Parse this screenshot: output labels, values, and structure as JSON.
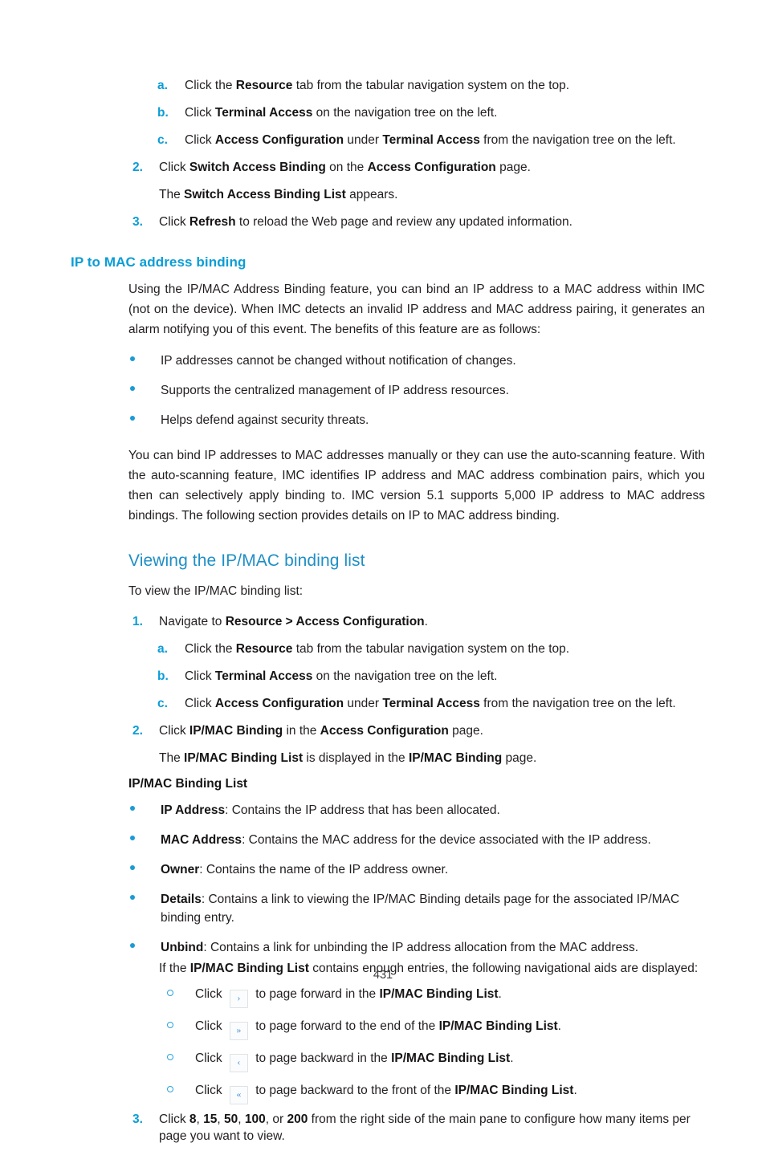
{
  "page": {
    "number": "431"
  },
  "top_steps": {
    "a": {
      "marker": "a.",
      "pre": "Click the ",
      "b1": "Resource",
      "post": " tab from the tabular navigation system on the top."
    },
    "b": {
      "marker": "b.",
      "pre": "Click ",
      "b1": "Terminal Access",
      "post": " on the navigation tree on the left."
    },
    "c": {
      "marker": "c.",
      "pre": "Click ",
      "b1": "Access Configuration",
      "mid": " under ",
      "b2": "Terminal Access",
      "post": " from the navigation tree on the left."
    },
    "step2": {
      "marker": "2.",
      "pre": "Click ",
      "b1": "Switch Access Binding",
      "mid": " on the ",
      "b2": "Access Configuration",
      "post": " page."
    },
    "step2_cont": {
      "pre": "The ",
      "b1": "Switch Access Binding List",
      "post": " appears."
    },
    "step3": {
      "marker": "3.",
      "pre": "Click ",
      "b1": "Refresh",
      "post": " to reload the Web page and review any updated information."
    }
  },
  "section1": {
    "heading": "IP to MAC address binding",
    "intro": "Using the IP/MAC Address Binding feature, you can bind an IP address to a MAC address within IMC (not on the device). When IMC detects an invalid IP address and MAC address pairing, it generates an alarm notifying you of this event. The benefits of this feature are as follows:",
    "benefits": [
      "IP addresses cannot be changed without notification of changes.",
      "Supports the centralized management of IP address resources.",
      "Helps defend against security threats."
    ],
    "outro": "You can bind IP addresses to MAC addresses manually or they can use the auto-scanning feature. With the auto-scanning feature, IMC identifies IP address and MAC address combination pairs, which you then can selectively apply binding to. IMC version 5.1 supports 5,000 IP address to MAC address bindings. The following section provides details on IP to MAC address binding."
  },
  "section2": {
    "heading": "Viewing the IP/MAC binding list",
    "lead": "To view the IP/MAC binding list:",
    "step1": {
      "marker": "1.",
      "pre": "Navigate to ",
      "b1": "Resource > Access Configuration",
      "post": "."
    },
    "a": {
      "marker": "a.",
      "pre": "Click the ",
      "b1": "Resource",
      "post": " tab from the tabular navigation system on the top."
    },
    "b": {
      "marker": "b.",
      "pre": "Click ",
      "b1": "Terminal Access",
      "post": " on the navigation tree on the left."
    },
    "c": {
      "marker": "c.",
      "pre": "Click ",
      "b1": "Access Configuration",
      "mid": " under ",
      "b2": "Terminal Access",
      "post": " from the navigation tree on the left."
    },
    "step2": {
      "marker": "2.",
      "pre": "Click ",
      "b1": "IP/MAC Binding",
      "mid": " in the ",
      "b2": "Access Configuration",
      "post": " page."
    },
    "step2_cont": {
      "pre": "The ",
      "b1": "IP/MAC Binding List",
      "mid": " is displayed in the ",
      "b2": "IP/MAC Binding",
      "post": " page."
    },
    "step3": {
      "marker": "3.",
      "pre": "Click ",
      "b1": "8",
      "s1": ", ",
      "b2": "15",
      "s2": ", ",
      "b3": "50",
      "s3": ", ",
      "b4": "100",
      "s4": ", or ",
      "b5": "200",
      "post": " from the right side of the main pane to configure how many items per page you want to view."
    }
  },
  "binding_list": {
    "subheading": "IP/MAC Binding List",
    "fields": [
      {
        "term": "IP Address",
        "desc": ": Contains the IP address that has been allocated."
      },
      {
        "term": "MAC Address",
        "desc": ": Contains the MAC address for the device associated with the IP address."
      },
      {
        "term": "Owner",
        "desc": ": Contains the name of the IP address owner."
      },
      {
        "term": "Details",
        "desc": ": Contains a link to viewing the IP/MAC Binding details page for the associated IP/MAC binding entry."
      },
      {
        "term": "Unbind",
        "desc": ": Contains a link for unbinding the IP address allocation from the MAC address."
      }
    ],
    "nav_intro": {
      "pre": "If the ",
      "b1": "IP/MAC Binding List",
      "post": " contains enough entries, the following navigational aids are displayed:"
    },
    "nav_aids": [
      {
        "pre": "Click ",
        "icon": "›",
        "icon_name": "page-forward-icon",
        "mid": " to page forward in the ",
        "b1": "IP/MAC Binding List",
        "post": "."
      },
      {
        "pre": "Click ",
        "icon": "»",
        "icon_name": "page-last-icon",
        "mid": " to page forward to the end of the ",
        "b1": "IP/MAC Binding List",
        "post": "."
      },
      {
        "pre": "Click ",
        "icon": "‹",
        "icon_name": "page-backward-icon",
        "mid": " to page backward in the ",
        "b1": "IP/MAC Binding List",
        "post": "."
      },
      {
        "pre": "Click ",
        "icon": "«",
        "icon_name": "page-first-icon",
        "mid": " to page backward to the front of the ",
        "b1": "IP/MAC Binding List",
        "post": "."
      }
    ]
  },
  "colors": {
    "accent_blue": "#0b9dd6",
    "heading_blue": "#1f8fc6",
    "bullet_blue": "#1b9ad6",
    "text": "#231f20"
  }
}
